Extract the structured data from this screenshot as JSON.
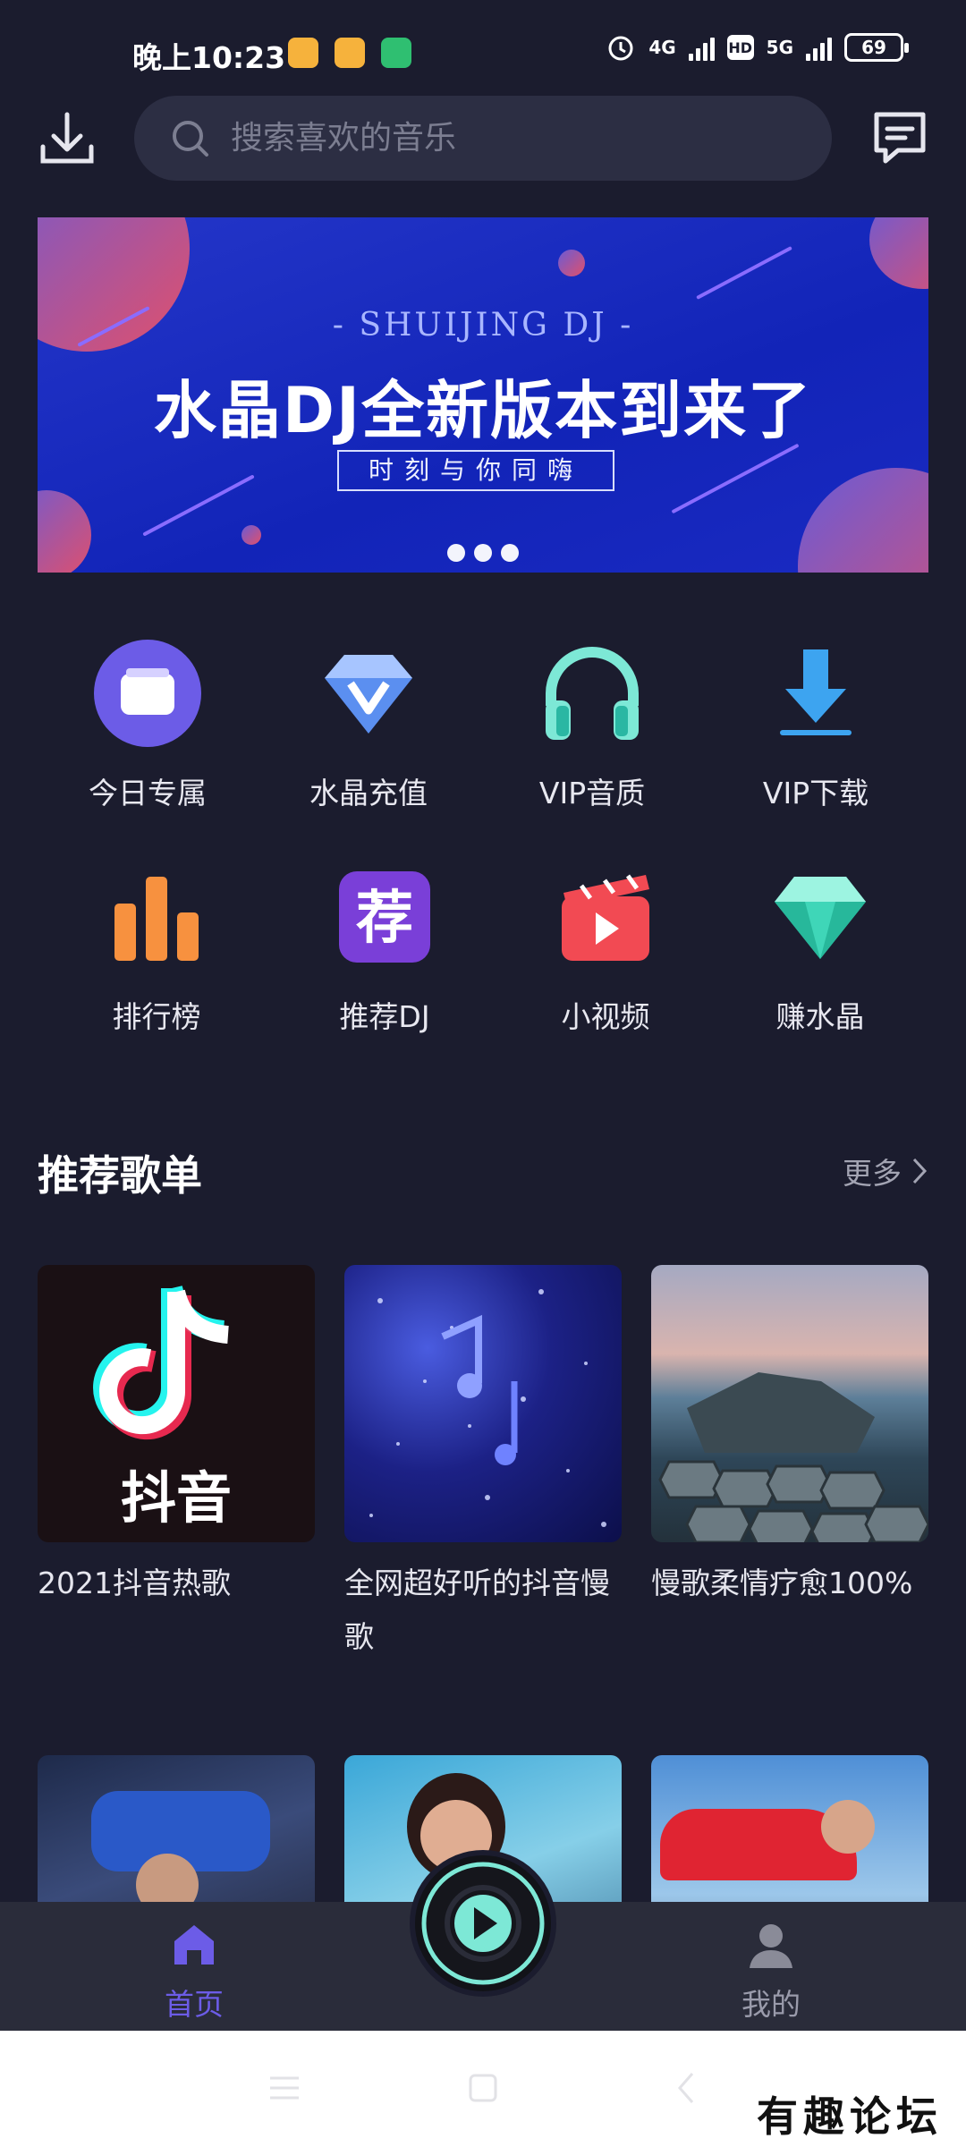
{
  "status_bar": {
    "time": "晚上10:23",
    "net1": "4G",
    "net2": "5G",
    "hd": "HD",
    "battery": "69"
  },
  "search": {
    "placeholder": "搜索喜欢的音乐"
  },
  "banner": {
    "subtitle": "- SHUIJING DJ -",
    "title": "水晶DJ全新版本到来了",
    "tagline": "时刻与你同嗨",
    "dots": 3
  },
  "menu": [
    {
      "label": "今日专属",
      "icon": "calendar-icon"
    },
    {
      "label": "水晶充值",
      "icon": "diamond-v-icon"
    },
    {
      "label": "VIP音质",
      "icon": "headphones-icon"
    },
    {
      "label": "VIP下载",
      "icon": "download-icon"
    },
    {
      "label": "排行榜",
      "icon": "bar-chart-icon"
    },
    {
      "label": "推荐DJ",
      "icon": "recommend-icon"
    },
    {
      "label": "小视频",
      "icon": "video-icon"
    },
    {
      "label": "赚水晶",
      "icon": "gem-icon"
    }
  ],
  "section": {
    "title": "推荐歌单",
    "more": "更多"
  },
  "playlists": [
    {
      "title": "2021抖音热歌",
      "cover_text": "抖音"
    },
    {
      "title": "全网超好听的抖音慢歌",
      "cover_text": ""
    },
    {
      "title": "慢歌柔情疗愈100%",
      "cover_text": ""
    },
    {
      "title": "",
      "cover_text": ""
    },
    {
      "title": "",
      "cover_text": ""
    },
    {
      "title": "",
      "cover_text": ""
    }
  ],
  "bottom_nav": {
    "home": "首页",
    "mine": "我的"
  },
  "colors": {
    "accent": "#6c5ce7",
    "bg": "#1b1c2e",
    "banner": "#1a2ac2"
  },
  "watermark": "有趣论坛"
}
